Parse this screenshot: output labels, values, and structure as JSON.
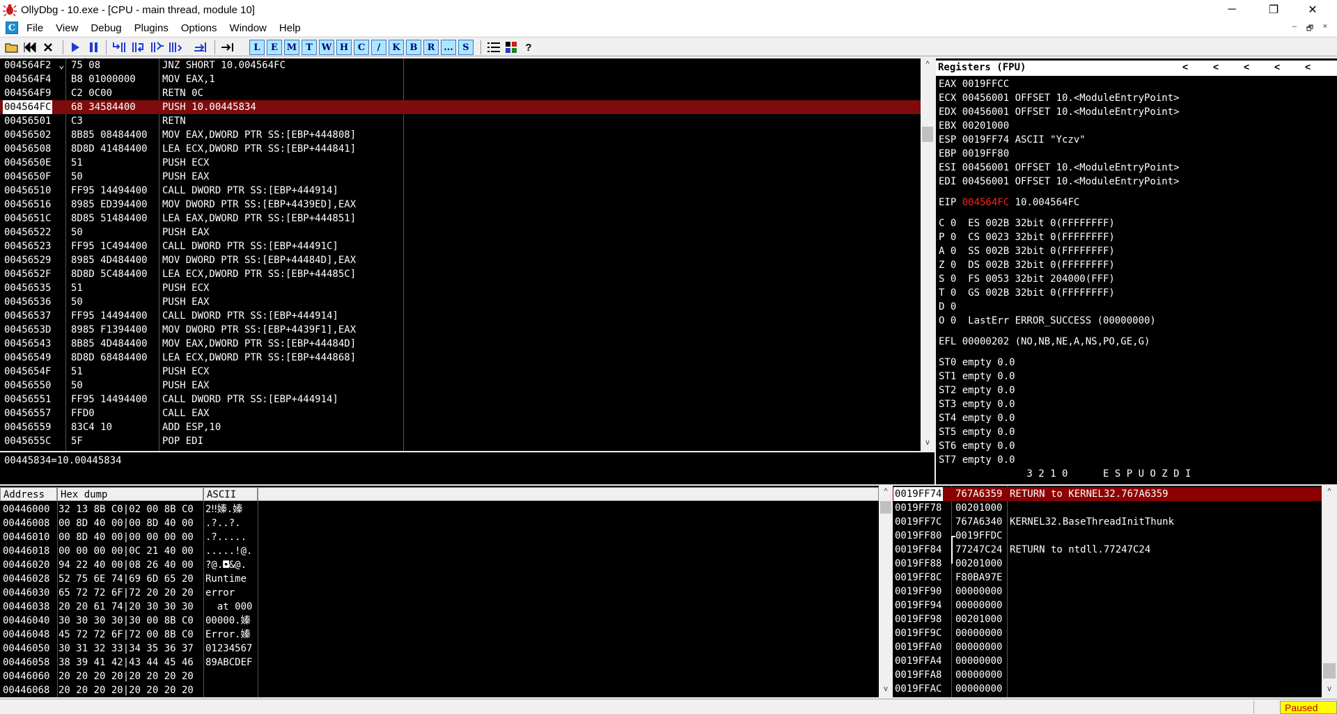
{
  "window": {
    "title": "OllyDbg - 10.exe - [CPU - main thread, module 10]",
    "min_glyph": "─",
    "restore_glyph": "❐",
    "close_glyph": "✕"
  },
  "menu": {
    "badge": "C",
    "items": [
      "File",
      "View",
      "Debug",
      "Plugins",
      "Options",
      "Window",
      "Help"
    ],
    "mdi_min": "–",
    "mdi_restore": "🗗",
    "mdi_close": "×"
  },
  "toolbar": {
    "letters": [
      "L",
      "E",
      "M",
      "T",
      "W",
      "H",
      "C",
      "/",
      "K",
      "B",
      "R",
      "...",
      "S"
    ],
    "help": "?"
  },
  "disasm": {
    "rows": [
      {
        "addr": "004564F2",
        "mark": "⌄",
        "hex": "75 08",
        "ins": "JNZ SHORT 10.004564FC"
      },
      {
        "addr": "004564F4",
        "mark": "",
        "hex": "B8 01000000",
        "ins": "MOV EAX,1"
      },
      {
        "addr": "004564F9",
        "mark": "",
        "hex": "C2 0C00",
        "ins": "RETN 0C"
      },
      {
        "addr": "004564FC",
        "mark": "",
        "hex": "68 34584400",
        "ins": "PUSH 10.00445834",
        "hl": true
      },
      {
        "addr": "00456501",
        "mark": "",
        "hex": "C3",
        "ins": "RETN"
      },
      {
        "addr": "00456502",
        "mark": "",
        "hex": "8B85 08484400",
        "ins": "MOV EAX,DWORD PTR SS:[EBP+444808]"
      },
      {
        "addr": "00456508",
        "mark": "",
        "hex": "8D8D 41484400",
        "ins": "LEA ECX,DWORD PTR SS:[EBP+444841]"
      },
      {
        "addr": "0045650E",
        "mark": "",
        "hex": "51",
        "ins": "PUSH ECX"
      },
      {
        "addr": "0045650F",
        "mark": "",
        "hex": "50",
        "ins": "PUSH EAX"
      },
      {
        "addr": "00456510",
        "mark": "",
        "hex": "FF95 14494400",
        "ins": "CALL DWORD PTR SS:[EBP+444914]"
      },
      {
        "addr": "00456516",
        "mark": "",
        "hex": "8985 ED394400",
        "ins": "MOV DWORD PTR SS:[EBP+4439ED],EAX"
      },
      {
        "addr": "0045651C",
        "mark": "",
        "hex": "8D85 51484400",
        "ins": "LEA EAX,DWORD PTR SS:[EBP+444851]"
      },
      {
        "addr": "00456522",
        "mark": "",
        "hex": "50",
        "ins": "PUSH EAX"
      },
      {
        "addr": "00456523",
        "mark": "",
        "hex": "FF95 1C494400",
        "ins": "CALL DWORD PTR SS:[EBP+44491C]"
      },
      {
        "addr": "00456529",
        "mark": "",
        "hex": "8985 4D484400",
        "ins": "MOV DWORD PTR SS:[EBP+44484D],EAX"
      },
      {
        "addr": "0045652F",
        "mark": "",
        "hex": "8D8D 5C484400",
        "ins": "LEA ECX,DWORD PTR SS:[EBP+44485C]"
      },
      {
        "addr": "00456535",
        "mark": "",
        "hex": "51",
        "ins": "PUSH ECX"
      },
      {
        "addr": "00456536",
        "mark": "",
        "hex": "50",
        "ins": "PUSH EAX"
      },
      {
        "addr": "00456537",
        "mark": "",
        "hex": "FF95 14494400",
        "ins": "CALL DWORD PTR SS:[EBP+444914]"
      },
      {
        "addr": "0045653D",
        "mark": "",
        "hex": "8985 F1394400",
        "ins": "MOV DWORD PTR SS:[EBP+4439F1],EAX"
      },
      {
        "addr": "00456543",
        "mark": "",
        "hex": "8B85 4D484400",
        "ins": "MOV EAX,DWORD PTR SS:[EBP+44484D]"
      },
      {
        "addr": "00456549",
        "mark": "",
        "hex": "8D8D 68484400",
        "ins": "LEA ECX,DWORD PTR SS:[EBP+444868]"
      },
      {
        "addr": "0045654F",
        "mark": "",
        "hex": "51",
        "ins": "PUSH ECX"
      },
      {
        "addr": "00456550",
        "mark": "",
        "hex": "50",
        "ins": "PUSH EAX"
      },
      {
        "addr": "00456551",
        "mark": "",
        "hex": "FF95 14494400",
        "ins": "CALL DWORD PTR SS:[EBP+444914]"
      },
      {
        "addr": "00456557",
        "mark": "",
        "hex": "FFD0",
        "ins": "CALL EAX"
      },
      {
        "addr": "00456559",
        "mark": "",
        "hex": "83C4 10",
        "ins": "ADD ESP,10"
      },
      {
        "addr": "0045655C",
        "mark": "",
        "hex": "5F",
        "ins": "POP EDI"
      }
    ]
  },
  "info_line": "00445834=10.00445834",
  "registers": {
    "title": "Registers (FPU)",
    "nav": "<",
    "lines": [
      {
        "text": "EAX 0019FFCC"
      },
      {
        "text": "ECX 00456001 OFFSET 10.<ModuleEntryPoint>"
      },
      {
        "text": "EDX 00456001 OFFSET 10.<ModuleEntryPoint>"
      },
      {
        "text": "EBX 00201000"
      },
      {
        "text": "ESP 0019FF74 ASCII \"Yczv\""
      },
      {
        "text": "EBP 0019FF80"
      },
      {
        "text": "ESI 00456001 OFFSET 10.<ModuleEntryPoint>"
      },
      {
        "text": "EDI 00456001 OFFSET 10.<ModuleEntryPoint>"
      },
      {
        "gap": true
      },
      {
        "pre": "EIP ",
        "red": "004564FC",
        "post": " 10.004564FC"
      },
      {
        "gap": true
      },
      {
        "text": "C 0  ES 002B 32bit 0(FFFFFFFF)"
      },
      {
        "text": "P 0  CS 0023 32bit 0(FFFFFFFF)"
      },
      {
        "text": "A 0  SS 002B 32bit 0(FFFFFFFF)"
      },
      {
        "text": "Z 0  DS 002B 32bit 0(FFFFFFFF)"
      },
      {
        "text": "S 0  FS 0053 32bit 204000(FFF)"
      },
      {
        "text": "T 0  GS 002B 32bit 0(FFFFFFFF)"
      },
      {
        "text": "D 0"
      },
      {
        "text": "O 0  LastErr ERROR_SUCCESS (00000000)"
      },
      {
        "gap": true
      },
      {
        "text": "EFL 00000202 (NO,NB,NE,A,NS,PO,GE,G)"
      },
      {
        "gap": true
      },
      {
        "text": "ST0 empty 0.0"
      },
      {
        "text": "ST1 empty 0.0"
      },
      {
        "text": "ST2 empty 0.0"
      },
      {
        "text": "ST3 empty 0.0"
      },
      {
        "text": "ST4 empty 0.0"
      },
      {
        "text": "ST5 empty 0.0"
      },
      {
        "text": "ST6 empty 0.0"
      },
      {
        "text": "ST7 empty 0.0"
      },
      {
        "text": "               3 2 1 0      E S P U O Z D I"
      }
    ]
  },
  "dump": {
    "headers": {
      "address": "Address",
      "hex": "Hex dump",
      "ascii": "ASCII"
    },
    "rows": [
      {
        "addr": "00446000",
        "hex": "32 13 8B C0|02 00 8B C0",
        "ascii": "2‼嫀.嫀"
      },
      {
        "addr": "00446008",
        "hex": "00 8D 40 00|00 8D 40 00",
        "ascii": ".?..?."
      },
      {
        "addr": "00446010",
        "hex": "00 8D 40 00|00 00 00 00",
        "ascii": ".?....."
      },
      {
        "addr": "00446018",
        "hex": "00 00 00 00|0C 21 40 00",
        "ascii": ".....!@."
      },
      {
        "addr": "00446020",
        "hex": "94 22 40 00|08 26 40 00",
        "ascii": "?@.◘&@."
      },
      {
        "addr": "00446028",
        "hex": "52 75 6E 74|69 6D 65 20",
        "ascii": "Runtime "
      },
      {
        "addr": "00446030",
        "hex": "65 72 72 6F|72 20 20 20",
        "ascii": "error   "
      },
      {
        "addr": "00446038",
        "hex": "20 20 61 74|20 30 30 30",
        "ascii": "  at 000"
      },
      {
        "addr": "00446040",
        "hex": "30 30 30 30|30 00 8B C0",
        "ascii": "00000.嫀"
      },
      {
        "addr": "00446048",
        "hex": "45 72 72 6F|72 00 8B C0",
        "ascii": "Error.嫀"
      },
      {
        "addr": "00446050",
        "hex": "30 31 32 33|34 35 36 37",
        "ascii": "01234567"
      },
      {
        "addr": "00446058",
        "hex": "38 39 41 42|43 44 45 46",
        "ascii": "89ABCDEF"
      },
      {
        "addr": "00446060",
        "hex": "20 20 20 20|20 20 20 20",
        "ascii": "        "
      },
      {
        "addr": "00446068",
        "hex": "20 20 20 20|20 20 20 20",
        "ascii": "        "
      }
    ]
  },
  "stack": {
    "rows": [
      {
        "addr": "0019FF74",
        "val": "767A6359",
        "comment": "RETURN to KERNEL32.767A6359",
        "hl": true
      },
      {
        "addr": "0019FF78",
        "val": "00201000",
        "comment": ""
      },
      {
        "addr": "0019FF7C",
        "val": "767A6340",
        "comment": "KERNEL32.BaseThreadInitThunk"
      },
      {
        "addr": "0019FF80",
        "val": "0019FFDC",
        "comment": "",
        "bracket": true
      },
      {
        "addr": "0019FF84",
        "val": "77247C24",
        "comment": "RETURN to ntdll.77247C24"
      },
      {
        "addr": "0019FF88",
        "val": "00201000",
        "comment": ""
      },
      {
        "addr": "0019FF8C",
        "val": "F80BA97E",
        "comment": ""
      },
      {
        "addr": "0019FF90",
        "val": "00000000",
        "comment": ""
      },
      {
        "addr": "0019FF94",
        "val": "00000000",
        "comment": ""
      },
      {
        "addr": "0019FF98",
        "val": "00201000",
        "comment": ""
      },
      {
        "addr": "0019FF9C",
        "val": "00000000",
        "comment": ""
      },
      {
        "addr": "0019FFA0",
        "val": "00000000",
        "comment": ""
      },
      {
        "addr": "0019FFA4",
        "val": "00000000",
        "comment": ""
      },
      {
        "addr": "0019FFA8",
        "val": "00000000",
        "comment": ""
      },
      {
        "addr": "0019FFAC",
        "val": "00000000",
        "comment": ""
      }
    ]
  },
  "status": {
    "state": "Paused"
  },
  "scroll": {
    "up": "▲",
    "down": "▼",
    "up_caret": "^",
    "down_caret": "v"
  }
}
